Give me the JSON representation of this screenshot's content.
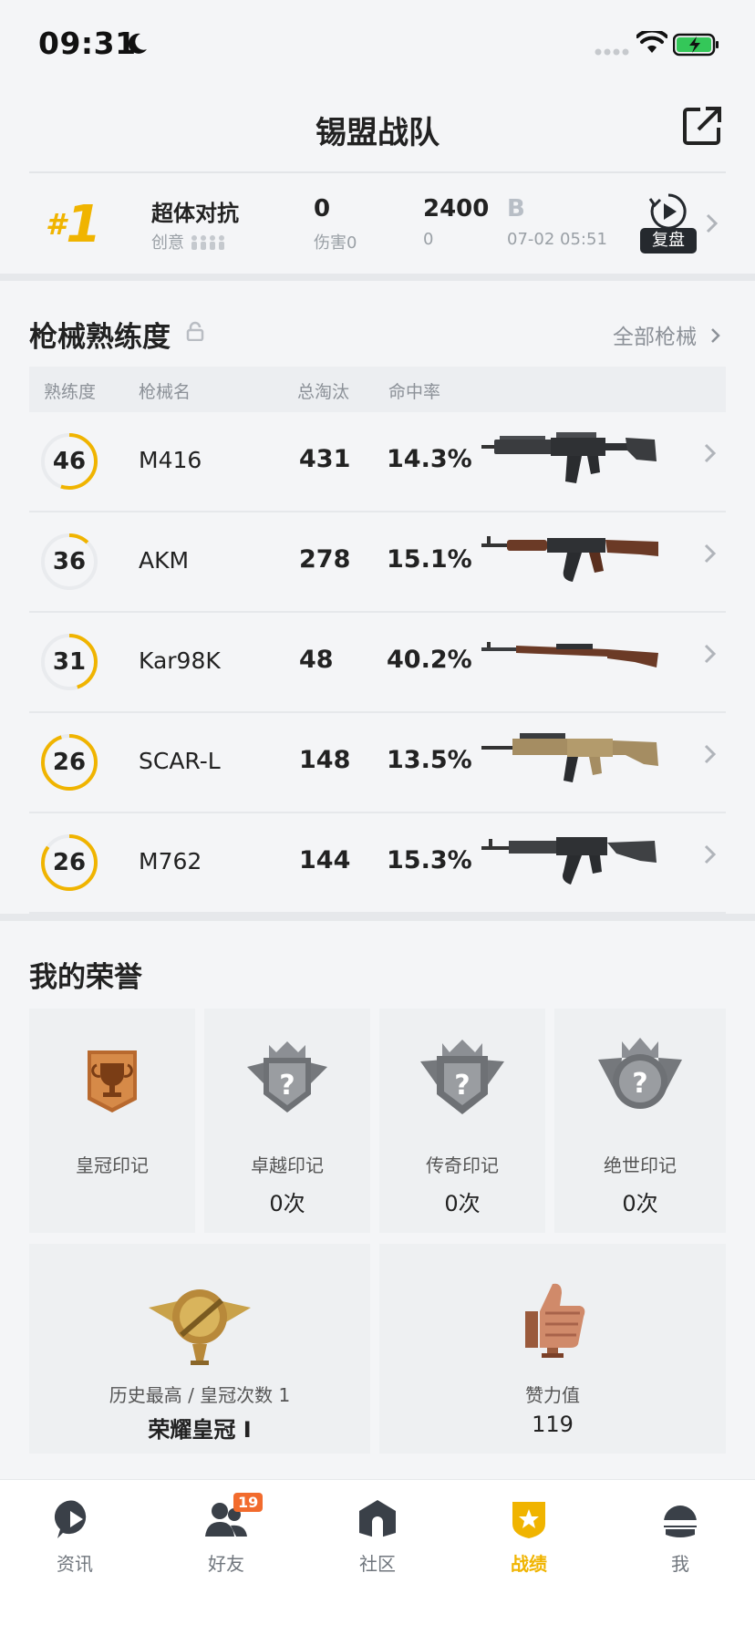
{
  "status_bar": {
    "time": "09:31"
  },
  "header": {
    "title": "锡盟战队"
  },
  "match": {
    "rank": "1",
    "mode": "超体对抗",
    "mode_sub": "创意",
    "stat1": "0",
    "stat1_sub": "伤害0",
    "stat2": "2400",
    "stat2_sub": "0",
    "grade": "B",
    "time": "07-02 05:51",
    "replay_label": "复盘"
  },
  "weapons": {
    "title": "枪械熟练度",
    "all_link": "全部枪械",
    "headers": {
      "proficiency": "熟练度",
      "name": "枪械名",
      "kills": "总淘汰",
      "accuracy": "命中率"
    },
    "rows": [
      {
        "level": "46",
        "name": "M416",
        "kills": "431",
        "accuracy": "14.3%",
        "progress": 0.55
      },
      {
        "level": "36",
        "name": "AKM",
        "kills": "278",
        "accuracy": "15.1%",
        "progress": 0.12
      },
      {
        "level": "31",
        "name": "Kar98K",
        "kills": "48",
        "accuracy": "40.2%",
        "progress": 0.45
      },
      {
        "level": "26",
        "name": "SCAR-L",
        "kills": "148",
        "accuracy": "13.5%",
        "progress": 0.95
      },
      {
        "level": "26",
        "name": "M762",
        "kills": "144",
        "accuracy": "15.3%",
        "progress": 0.85
      }
    ]
  },
  "honors": {
    "title": "我的荣誉",
    "crown": {
      "label": "皇冠印记"
    },
    "excellent": {
      "label": "卓越印记",
      "count": "0次"
    },
    "legend": {
      "label": "传奇印记",
      "count": "0次"
    },
    "peerless": {
      "label": "绝世印记",
      "count": "0次"
    },
    "history": {
      "label": "历史最高 / 皇冠次数 1",
      "value": "荣耀皇冠 I"
    },
    "likes": {
      "label": "赞力值",
      "value": "119"
    }
  },
  "tabbar": {
    "tabs": [
      {
        "label": "资讯"
      },
      {
        "label": "好友",
        "badge": "19"
      },
      {
        "label": "社区"
      },
      {
        "label": "战绩"
      },
      {
        "label": "我"
      }
    ]
  },
  "colors": {
    "accent": "#f0b400",
    "badge": "#f26b2d"
  }
}
